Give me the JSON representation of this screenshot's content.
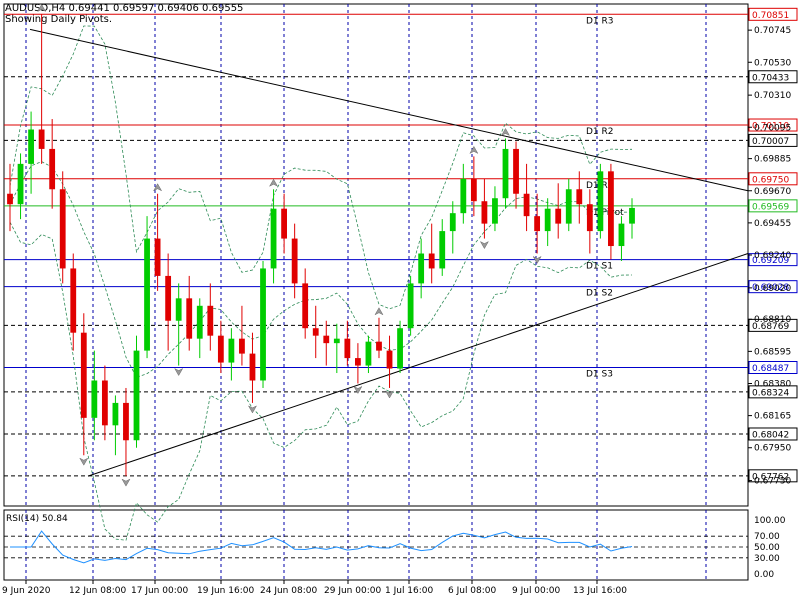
{
  "header": {
    "symbol_line": "AUDUSD,H4  0.69441 0.69597 0.69406 0.69555",
    "subtitle": "Showing Daily Pivots."
  },
  "rsi_panel": {
    "label": "RSI(14) 50.84",
    "ticks": [
      "100.00",
      "70.00",
      "50.00",
      "30.00",
      "0.00"
    ]
  },
  "colors": {
    "bull": "#00cc00",
    "bear": "#e00000",
    "resistance": "#dd0000",
    "support": "#0000cc",
    "pivot": "#22bb22",
    "rsi_line": "#1e90ff",
    "bands": "#2e8b57"
  },
  "chart_data": {
    "type": "candlestick",
    "instrument": "AUDUSD",
    "timeframe": "H4",
    "y_ticks": [
      "0.70745",
      "0.70530",
      "0.70310",
      "0.70095",
      "0.69885",
      "0.69670",
      "0.69455",
      "0.69240",
      "0.69020",
      "0.68810",
      "0.68595",
      "0.68380",
      "0.68165",
      "0.67950",
      "0.67730"
    ],
    "x_tick_labels": [
      "9 Jun 2020",
      "12 Jun 08:00",
      "17 Jun 00:00",
      "19 Jun 16:00",
      "24 Jun 08:00",
      "29 Jun 00:00",
      "1 Jul 16:00",
      "6 Jul 08:00",
      "9 Jul 00:00",
      "13 Jul 16:00"
    ],
    "pivot_levels": [
      {
        "name": "D1 R3",
        "price": "0.70851",
        "kind": "resistance"
      },
      {
        "name": "D1 R2",
        "price": "0.70110",
        "kind": "resistance"
      },
      {
        "name": "D1 R1",
        "price": "0.69750",
        "kind": "resistance"
      },
      {
        "name": "D1 Pivot",
        "price": "0.69569",
        "kind": "pivot"
      },
      {
        "name": "D1 S1",
        "price": "0.69209",
        "kind": "support"
      },
      {
        "name": "D1 S2",
        "price": "0.69028",
        "kind": "support"
      },
      {
        "name": "D1 S3",
        "price": "0.68487",
        "kind": "support"
      }
    ],
    "dashed_levels": [
      "0.70433",
      "0.70007",
      "0.68769",
      "0.68324",
      "0.68042",
      "0.67762"
    ],
    "trendlines": [
      {
        "name": "upper",
        "from_price": 0.7075,
        "to_price": 0.6967
      },
      {
        "name": "lower",
        "from_price": 0.6776,
        "to_price": 0.6925
      }
    ],
    "last_price": "0.69555",
    "rsi_value": 50.84,
    "candles": [
      [
        0.6965,
        0.6985,
        0.694,
        0.6958
      ],
      [
        0.6958,
        0.6992,
        0.6948,
        0.6985
      ],
      [
        0.6985,
        0.702,
        0.6965,
        0.7008
      ],
      [
        0.7008,
        0.7085,
        0.6985,
        0.6995
      ],
      [
        0.6995,
        0.7015,
        0.6955,
        0.6968
      ],
      [
        0.6968,
        0.698,
        0.6905,
        0.6915
      ],
      [
        0.6915,
        0.6925,
        0.686,
        0.6872
      ],
      [
        0.6872,
        0.6885,
        0.679,
        0.6815
      ],
      [
        0.6815,
        0.686,
        0.68,
        0.684
      ],
      [
        0.684,
        0.685,
        0.68,
        0.681
      ],
      [
        0.681,
        0.683,
        0.679,
        0.6825
      ],
      [
        0.6825,
        0.6835,
        0.6776,
        0.68
      ],
      [
        0.68,
        0.687,
        0.6795,
        0.686
      ],
      [
        0.686,
        0.695,
        0.6855,
        0.6935
      ],
      [
        0.6935,
        0.6965,
        0.69,
        0.691
      ],
      [
        0.691,
        0.6925,
        0.686,
        0.688
      ],
      [
        0.688,
        0.6905,
        0.685,
        0.6895
      ],
      [
        0.6895,
        0.691,
        0.686,
        0.6868
      ],
      [
        0.6868,
        0.6895,
        0.6855,
        0.689
      ],
      [
        0.689,
        0.6905,
        0.686,
        0.687
      ],
      [
        0.687,
        0.688,
        0.6845,
        0.6852
      ],
      [
        0.6852,
        0.6875,
        0.684,
        0.6868
      ],
      [
        0.6868,
        0.689,
        0.685,
        0.6858
      ],
      [
        0.6858,
        0.6872,
        0.6825,
        0.684
      ],
      [
        0.684,
        0.692,
        0.6835,
        0.6915
      ],
      [
        0.6915,
        0.6968,
        0.6905,
        0.6955
      ],
      [
        0.6955,
        0.6965,
        0.6925,
        0.6935
      ],
      [
        0.6935,
        0.6945,
        0.6895,
        0.6905
      ],
      [
        0.6905,
        0.6915,
        0.6868,
        0.6875
      ],
      [
        0.6875,
        0.689,
        0.6855,
        0.687
      ],
      [
        0.687,
        0.688,
        0.685,
        0.6865
      ],
      [
        0.6865,
        0.6878,
        0.6845,
        0.6868
      ],
      [
        0.6868,
        0.688,
        0.685,
        0.6855
      ],
      [
        0.6855,
        0.6865,
        0.6838,
        0.685
      ],
      [
        0.685,
        0.687,
        0.6845,
        0.6866
      ],
      [
        0.6866,
        0.6882,
        0.6855,
        0.686
      ],
      [
        0.686,
        0.687,
        0.6835,
        0.6848
      ],
      [
        0.6848,
        0.688,
        0.6845,
        0.6875
      ],
      [
        0.6875,
        0.691,
        0.687,
        0.6905
      ],
      [
        0.6905,
        0.6935,
        0.6895,
        0.6925
      ],
      [
        0.6925,
        0.6945,
        0.6905,
        0.6915
      ],
      [
        0.6915,
        0.6948,
        0.691,
        0.694
      ],
      [
        0.694,
        0.696,
        0.6925,
        0.6952
      ],
      [
        0.6952,
        0.6985,
        0.6945,
        0.6975
      ],
      [
        0.6975,
        0.699,
        0.695,
        0.696
      ],
      [
        0.696,
        0.6975,
        0.6935,
        0.6945
      ],
      [
        0.6945,
        0.697,
        0.694,
        0.6962
      ],
      [
        0.6962,
        0.7002,
        0.6955,
        0.6995
      ],
      [
        0.6995,
        0.7,
        0.6955,
        0.6965
      ],
      [
        0.6965,
        0.6985,
        0.694,
        0.695
      ],
      [
        0.695,
        0.6965,
        0.6925,
        0.694
      ],
      [
        0.694,
        0.6962,
        0.693,
        0.6955
      ],
      [
        0.6955,
        0.6972,
        0.6935,
        0.6945
      ],
      [
        0.6945,
        0.6975,
        0.694,
        0.6968
      ],
      [
        0.6968,
        0.698,
        0.6945,
        0.6958
      ],
      [
        0.6958,
        0.6968,
        0.6925,
        0.694
      ],
      [
        0.694,
        0.6985,
        0.6935,
        0.698
      ],
      [
        0.698,
        0.6985,
        0.6921,
        0.693
      ],
      [
        0.693,
        0.695,
        0.692,
        0.6945
      ],
      [
        0.6945,
        0.6962,
        0.6935,
        0.69555
      ]
    ]
  }
}
